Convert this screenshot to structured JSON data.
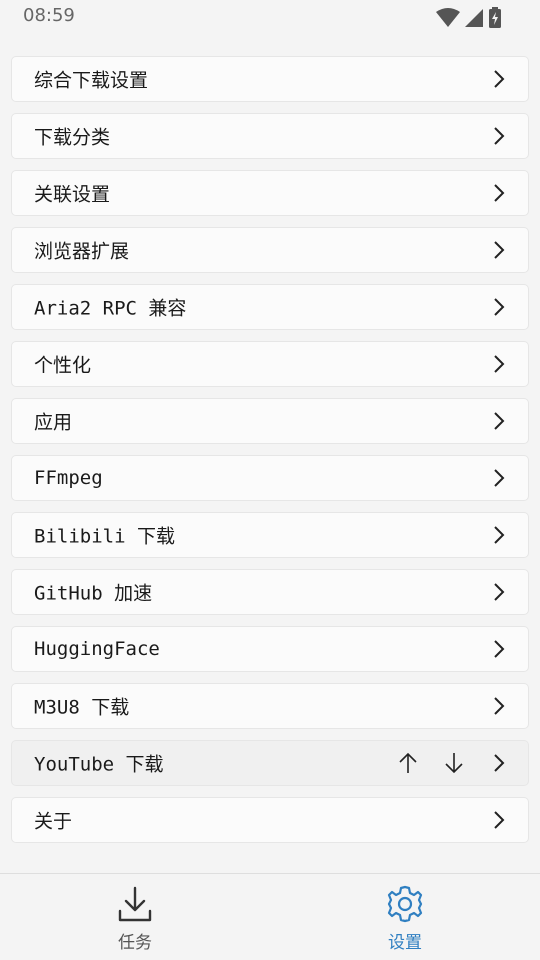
{
  "status_bar": {
    "time": "08:59",
    "icons": [
      "wifi-icon",
      "signal-icon",
      "battery-charging-icon"
    ]
  },
  "settings": {
    "items": [
      {
        "label": "综合下载设置"
      },
      {
        "label": "下载分类"
      },
      {
        "label": "关联设置"
      },
      {
        "label": "浏览器扩展"
      },
      {
        "label": "Aria2 RPC 兼容"
      },
      {
        "label": "个性化"
      },
      {
        "label": "应用"
      },
      {
        "label": "FFmpeg"
      },
      {
        "label": "Bilibili 下载"
      },
      {
        "label": "GitHub 加速"
      },
      {
        "label": "HuggingFace"
      },
      {
        "label": "M3U8 下载"
      },
      {
        "label": "YouTube 下载"
      },
      {
        "label": "关于"
      }
    ]
  },
  "bottom_nav": {
    "tasks_label": "任务",
    "settings_label": "设置",
    "active": "settings"
  },
  "colors": {
    "accent": "#2f7fc1",
    "background": "#f4f4f4",
    "card": "#fbfbfb"
  }
}
